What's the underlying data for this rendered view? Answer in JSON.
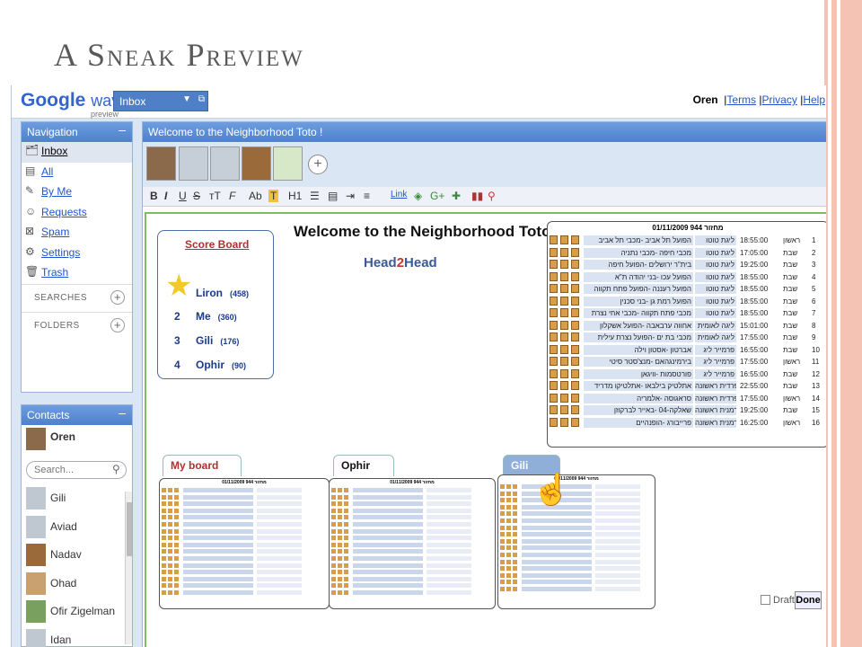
{
  "slide": {
    "title": "A Sneak Preview"
  },
  "app": {
    "logo": "Google",
    "logo_wave": "wave",
    "logo_preview": "preview",
    "inbox_select": "Inbox"
  },
  "user": {
    "name": "Oren",
    "terms": "Terms",
    "privacy": "Privacy",
    "help": "Help"
  },
  "navigation": {
    "title": "Navigation",
    "items": [
      "Inbox",
      "All",
      "By Me",
      "Requests",
      "Spam",
      "Settings",
      "Trash"
    ],
    "searches": "SEARCHES",
    "folders": "FOLDERS"
  },
  "contacts": {
    "title": "Contacts",
    "me": "Oren",
    "search_placeholder": "Search...",
    "list": [
      "Gili",
      "Aviad",
      "Nadav",
      "Ohad",
      "Ofir Zigelman",
      "Idan"
    ]
  },
  "wave": {
    "header": "Welcome to the Neighborhood Toto !",
    "title": "Welcome to the Neighborhood Toto !",
    "head": "Head",
    "two": "2",
    "head2": "Head"
  },
  "toolbar": {
    "link": "Link"
  },
  "scoreboard": {
    "title": "Score Board",
    "rows": [
      {
        "rank": "1",
        "name": "Liron",
        "points": "(458)"
      },
      {
        "rank": "2",
        "name": "Me",
        "points": "(360)"
      },
      {
        "rank": "3",
        "name": "Gili",
        "points": "(176)"
      },
      {
        "rank": "4",
        "name": "Ophir",
        "points": "(90)"
      }
    ]
  },
  "table": {
    "header": "מחזור 944 01/11/2009",
    "rows": [
      {
        "n": "1",
        "day": "ראשון",
        "time": "18:55:00",
        "league": "ליגת טוטו",
        "match": "הפועל תל אביב -מכבי תל אביב"
      },
      {
        "n": "2",
        "day": "שבת",
        "time": "17:05:00",
        "league": "ליגת טוטו",
        "match": "מכבי חיפה -מכבי נתניה"
      },
      {
        "n": "3",
        "day": "שבת",
        "time": "19:25:00",
        "league": "ליגת טוטו",
        "match": "בית\"ר ירושלים -הפועל חיפה"
      },
      {
        "n": "4",
        "day": "שבת",
        "time": "18:55:00",
        "league": "ליגת טוטו",
        "match": "הפועל עכו -בני יהודה ת\"א"
      },
      {
        "n": "5",
        "day": "שבת",
        "time": "18:55:00",
        "league": "ליגת טוטו",
        "match": "הפועל רעננה -הפועל פתח תקווה"
      },
      {
        "n": "6",
        "day": "שבת",
        "time": "18:55:00",
        "league": "ליגת טוטו",
        "match": "הפועל רמת גן -בני סכנין"
      },
      {
        "n": "7",
        "day": "שבת",
        "time": "18:55:00",
        "league": "ליגת טוטו",
        "match": "מכבי פתח תקווה -מכבי אחי נצרת"
      },
      {
        "n": "8",
        "day": "שבת",
        "time": "15:01:00",
        "league": "ליגה לאומית",
        "match": "אחווה ערבאבה -הפועל אשקלון"
      },
      {
        "n": "9",
        "day": "שבת",
        "time": "17:55:00",
        "league": "ליגה לאומית",
        "match": "מכבי בת ים -הפועל נצרת עילית"
      },
      {
        "n": "10",
        "day": "שבת",
        "time": "16:55:00",
        "league": "פרמייר ליג",
        "match": "אברטון -אסטון וילה"
      },
      {
        "n": "11",
        "day": "ראשון",
        "time": "17:55:00",
        "league": "פרמייר ליג",
        "match": "בירמינגהאם -מנצ'סטר סיטי"
      },
      {
        "n": "12",
        "day": "שבת",
        "time": "16:55:00",
        "league": "פרמייר ליג",
        "match": "פורטסמות -וויגאן"
      },
      {
        "n": "13",
        "day": "שבת",
        "time": "22:55:00",
        "league": "ספרדית ראשונה",
        "match": "אתלטיק בילבאו -אתלטיקו מדריד"
      },
      {
        "n": "14",
        "day": "ראשון",
        "time": "17:55:00",
        "league": "ספרדית ראשונה",
        "match": "סראגוסה -אלמריה"
      },
      {
        "n": "15",
        "day": "שבת",
        "time": "19:25:00",
        "league": "גרמנית ראשונה",
        "match": "שאלקה-04 -באייר לברקוזן"
      },
      {
        "n": "16",
        "day": "ראשון",
        "time": "16:25:00",
        "league": "גרמנית ראשונה",
        "match": "פרייבורג -הופנהיים"
      }
    ]
  },
  "boards": [
    "My board",
    "Ophir",
    "Gili"
  ],
  "footer": {
    "draft": "Draft",
    "done": "Done"
  }
}
